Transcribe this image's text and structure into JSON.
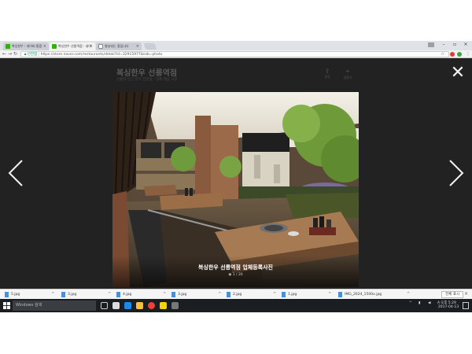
{
  "browser": {
    "tabs": [
      {
        "label": "복싱한우 : 네이버 통합",
        "active": false,
        "icon": "naver-icon"
      },
      {
        "label": "복싱한우 선릉역점 : 네이",
        "active": true,
        "icon": "naver-icon"
      },
      {
        "label": "형성되는 중입니다",
        "active": false,
        "icon": "document-icon"
      }
    ],
    "url_secure_label": "안전함",
    "url": "https://store.naver.com/restaurants/detail?id=32915977&tab=photo"
  },
  "viewer": {
    "shop_title": "복싱한우 선릉역점",
    "shop_subtitle": "선릉역 인근 한우 전문점 · 업체 제공 사진",
    "top_actions": [
      {
        "label": "공유",
        "icon": "share-icon"
      },
      {
        "label": "길찾기",
        "icon": "directions-icon"
      }
    ],
    "caption_title": "복싱한우 선릉역점 업체등록사진",
    "caption_count": "1 / 20"
  },
  "downloads": [
    {
      "name": "5.jpg"
    },
    {
      "name": "3.jpg"
    },
    {
      "name": "4.jpg"
    },
    {
      "name": "3.jpg"
    },
    {
      "name": "2.jpg"
    },
    {
      "name": "1.jpg"
    },
    {
      "name": "IMG_2024_1500x.jpg"
    }
  ],
  "download_showall": "전체 표시",
  "taskbar": {
    "search_placeholder": "Windows 검색",
    "time": "오후 5:29",
    "date": "2017-04-13"
  },
  "colors": {
    "viewer_bg": "#222222",
    "naver_green": "#2db400",
    "taskbar_bg": "#1a1d22"
  }
}
